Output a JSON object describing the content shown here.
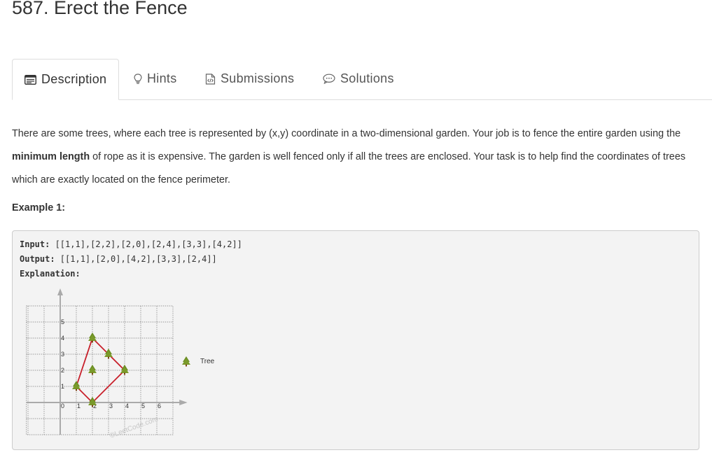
{
  "problem": {
    "title": "587. Erect the Fence"
  },
  "tabs": [
    {
      "label": "Description",
      "icon": "description-icon",
      "active": true
    },
    {
      "label": "Hints",
      "icon": "lightbulb-icon",
      "active": false
    },
    {
      "label": "Submissions",
      "icon": "code-file-icon",
      "active": false
    },
    {
      "label": "Solutions",
      "icon": "chat-bubble-icon",
      "active": false
    }
  ],
  "description": {
    "part1": "There are some trees, where each tree is represented by (x,y) coordinate in a two-dimensional garden. Your job is to fence the entire garden using the ",
    "bold": "minimum length",
    "part2": " of rope as it is expensive. The garden is well fenced only if all the trees are enclosed. Your task is to help find the coordinates of trees which are exactly located on the fence perimeter."
  },
  "example": {
    "title": "Example 1:",
    "input_label": "Input:",
    "input_value": " [[1,1],[2,2],[2,0],[2,4],[3,3],[4,2]]",
    "output_label": "Output:",
    "output_value": " [[1,1],[2,0],[4,2],[3,3],[2,4]]",
    "explanation_label": "Explanation:"
  },
  "figure": {
    "x_ticks": [
      "0",
      "1",
      "2",
      "3",
      "4",
      "5",
      "6"
    ],
    "y_ticks": [
      "1",
      "2",
      "3",
      "4",
      "5"
    ],
    "trees": [
      [
        1,
        1
      ],
      [
        2,
        2
      ],
      [
        2,
        0
      ],
      [
        2,
        4
      ],
      [
        3,
        3
      ],
      [
        4,
        2
      ]
    ],
    "fence": [
      [
        1,
        1
      ],
      [
        2,
        0
      ],
      [
        4,
        2
      ],
      [
        3,
        3
      ],
      [
        2,
        4
      ]
    ],
    "legend_label": "Tree",
    "watermark": "©LeetCode.com",
    "fence_color": "#c8202b",
    "tree_color": "#6b8e23"
  }
}
